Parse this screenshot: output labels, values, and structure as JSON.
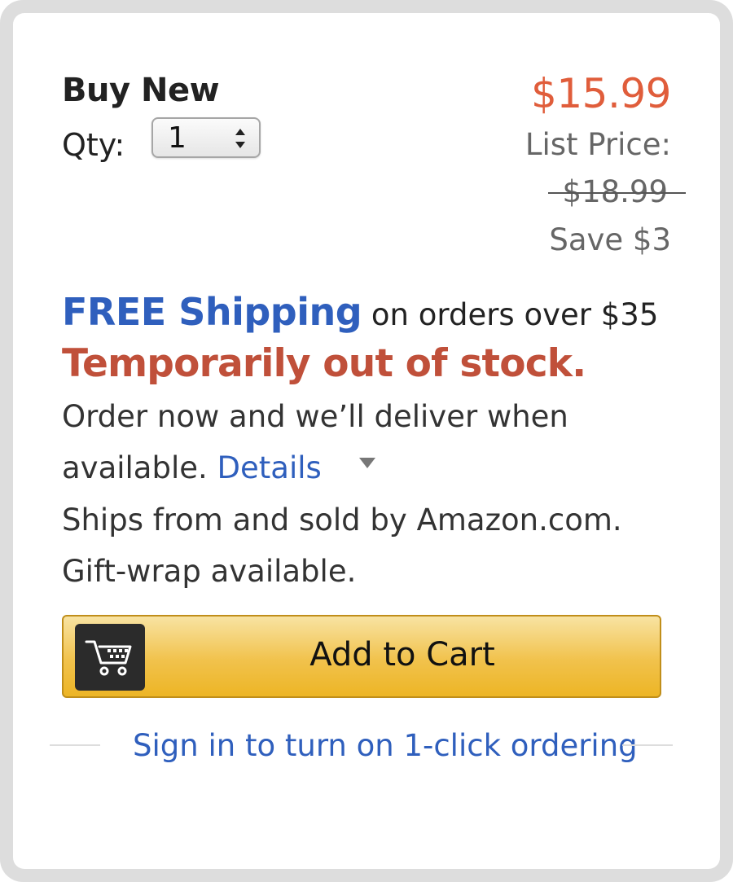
{
  "offer": {
    "heading": "Buy New",
    "qty_label": "Qty:",
    "qty_value": "1",
    "price": "$15.99",
    "list_price_label": "List Price:",
    "list_price": "$18.99",
    "savings": "Save $3"
  },
  "shipping": {
    "free_label": "FREE Shipping",
    "condition": "on orders over $35"
  },
  "availability": {
    "status": "Temporarily out of stock.",
    "line1": "Order now and we’ll deliver when",
    "line2_prefix": "available.",
    "details_link": "Details",
    "seller": "Ships from and sold by Amazon.com.",
    "gift": "Gift-wrap available."
  },
  "actions": {
    "add_to_cart": "Add to Cart",
    "one_click": "Sign in to turn on 1-click ordering"
  },
  "icons": {
    "qty": "up-down-arrows-icon",
    "details": "triangle-down-icon",
    "cart": "shopping-cart-icon"
  },
  "colors": {
    "price": "#e05d3b",
    "out_of_stock": "#c0503a",
    "link": "#2f5fbd",
    "button": "#f1c24c"
  }
}
